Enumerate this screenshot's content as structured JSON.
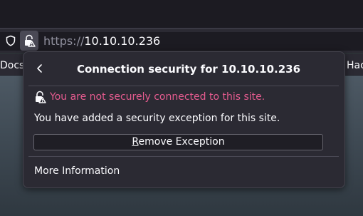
{
  "urlbar": {
    "scheme": "https://",
    "host": "10.10.10.236"
  },
  "bookmarks": {
    "left_item": "Docs",
    "right_item": "Hac"
  },
  "panel": {
    "title": "Connection security for 10.10.10.236",
    "warning": "You are not securely connected to this site.",
    "exception_message": "You have added a security exception for this site.",
    "remove_button": {
      "access_key": "R",
      "label_rest": "emove Exception"
    },
    "more_info": "More Information"
  },
  "icons": {
    "shield": "shield-icon",
    "lock_warning": "lock-warning-icon",
    "back": "chevron-left-icon"
  },
  "colors": {
    "warning_text": "#e55b8f",
    "panel_bg": "#2b2a33",
    "text": "#fbfbfe"
  }
}
